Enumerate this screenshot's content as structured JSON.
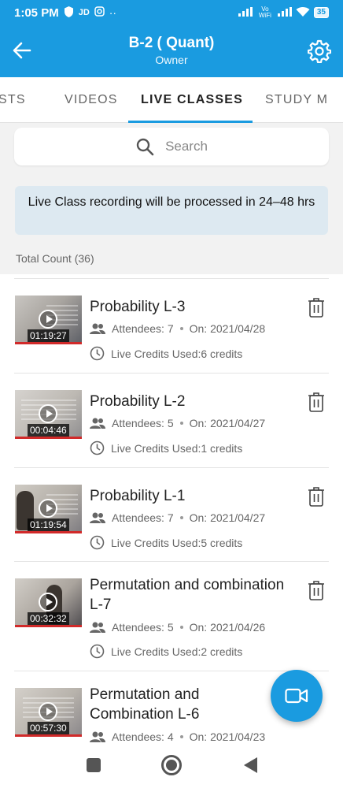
{
  "status_bar": {
    "time": "1:05 PM",
    "left_icons": [
      "JD"
    ],
    "network": "Vo WiFi",
    "battery": "35"
  },
  "header": {
    "title": "B-2 ( Quant)",
    "subtitle": "Owner"
  },
  "tabs": [
    {
      "label": "STS"
    },
    {
      "label": "VIDEOS"
    },
    {
      "label": "LIVE CLASSES"
    },
    {
      "label": "STUDY M"
    }
  ],
  "active_tab": "LIVE CLASSES",
  "search": {
    "placeholder": "Search"
  },
  "notice": "Live Class recording will be processed in 24–48 hrs",
  "total_count": "Total Count (36)",
  "items": [
    {
      "title": "Probability L-3",
      "duration": "01:19:27",
      "attendees": "Attendees: 7",
      "date": "On: 2021/04/28",
      "credits": "Live Credits Used:6 credits"
    },
    {
      "title": "Probability L-2",
      "duration": "00:04:46",
      "attendees": "Attendees: 5",
      "date": "On: 2021/04/27",
      "credits": "Live Credits Used:1 credits"
    },
    {
      "title": "Probability L-1",
      "duration": "01:19:54",
      "attendees": "Attendees: 7",
      "date": "On: 2021/04/27",
      "credits": "Live Credits Used:5 credits"
    },
    {
      "title": "Permutation and combination L-7",
      "duration": "00:32:32",
      "attendees": "Attendees: 5",
      "date": "On: 2021/04/26",
      "credits": "Live Credits Used:2 credits"
    },
    {
      "title": "Permutation and Combination L-6",
      "duration": "00:57:30",
      "attendees": "Attendees: 4",
      "date": "On: 2021/04/23",
      "credits": ""
    }
  ],
  "colors": {
    "primary": "#1a9be0",
    "notice_bg": "#dde9f1",
    "page_bg": "#f2f2f2"
  }
}
